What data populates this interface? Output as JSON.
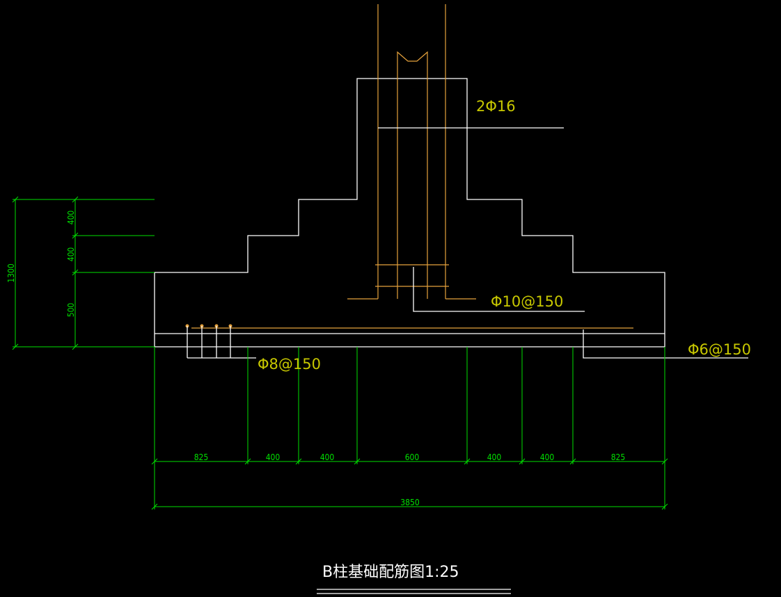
{
  "drawing": {
    "title": "B柱基础配筋图1:25",
    "rebar_labels": {
      "column_main": "2Φ16",
      "stirrup": "Φ10@150",
      "bottom_left": "Φ8@150",
      "bottom_right": "Φ6@150"
    },
    "dims_bottom": [
      "825",
      "400",
      "400",
      "600",
      "400",
      "400",
      "825"
    ],
    "dim_total_width": "3850",
    "dims_left": [
      "400",
      "400",
      "500"
    ],
    "dim_total_height": "1300"
  },
  "colors": {
    "background": "#000000",
    "outline": "#ffffff",
    "rebar": "#e6a23c",
    "dimension": "#00e000",
    "label": "#c8c800"
  }
}
